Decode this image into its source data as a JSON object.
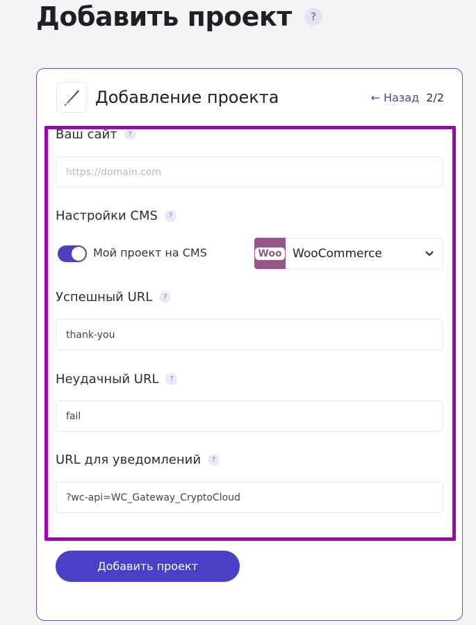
{
  "page": {
    "title": "Добавить проект",
    "help": "?"
  },
  "card": {
    "title": "Добавление проекта",
    "back_label": "Назад",
    "back_arrow": "←",
    "step": "2/2"
  },
  "form": {
    "site": {
      "label": "Ваш сайт",
      "help": "?",
      "placeholder": "https://domain.com",
      "value": ""
    },
    "cms": {
      "label": "Настройки CMS",
      "help": "?",
      "toggle_label": "Мой проект на CMS",
      "toggle_on": true,
      "logo_text": "Woo",
      "selected": "WooCommerce"
    },
    "success_url": {
      "label": "Успешный URL",
      "help": "?",
      "value": "thank-you"
    },
    "fail_url": {
      "label": "Неудачный URL",
      "help": "?",
      "value": "fail"
    },
    "notify_url": {
      "label": "URL для уведомлений",
      "help": "?",
      "value": "?wc-api=WC_Gateway_CryptoCloud"
    },
    "submit_label": "Добавить проект"
  },
  "colors": {
    "accent": "#4a40c8",
    "highlight": "#a000b8",
    "woo": "#96588a"
  }
}
